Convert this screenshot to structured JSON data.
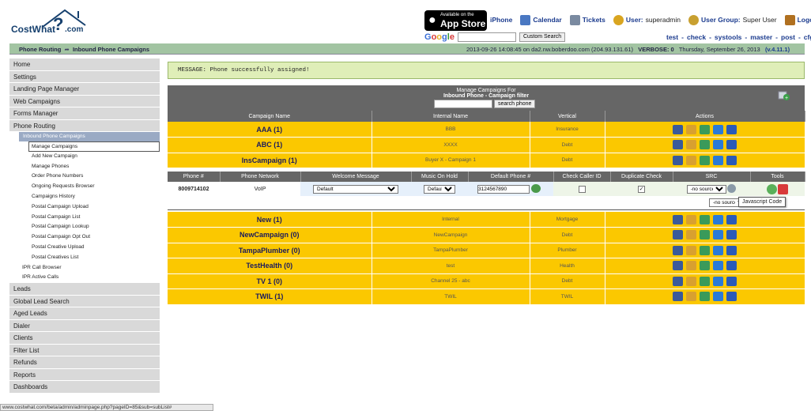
{
  "brand": {
    "logo_text": "CostWhat",
    "logo_q": "?",
    "logo_com": ".com"
  },
  "appstore": {
    "line1": "Available on the",
    "line2": "App Store"
  },
  "topnav": {
    "iphone": "iPhone",
    "calendar": "Calendar",
    "tickets": "Tickets",
    "user_label": "User:",
    "user_value": "superadmin",
    "group_label": "User Group:",
    "group_value": "Super User",
    "logout": "Logout"
  },
  "google": {
    "logo": "Google",
    "button": "Custom Search"
  },
  "subnav": [
    "test",
    "-",
    "check",
    "-",
    "systools",
    "-",
    "master",
    "-",
    "post",
    "-",
    "cfg"
  ],
  "breadcrumb": {
    "parent": "Phone Routing",
    "child": "Inbound Phone Campaigns"
  },
  "server": {
    "info": "2013-09-26 14:08:45 on da2.nw.boberdoo.com (204.93.131.61)",
    "verbose": "VERBOSE: 0",
    "date": "Thursday, September 26, 2013",
    "version": "(v.4.11.1)"
  },
  "sidebar": {
    "items_top": [
      "Home",
      "Settings",
      "Landing Page Manager",
      "Web Campaigns",
      "Forms Manager",
      "Phone Routing"
    ],
    "subhead": "Inbound Phone Campaigns",
    "subitems": [
      "Manage Campaigns",
      "Add New Campaign",
      "Manage Phones",
      "Order Phone Numbers",
      "Ongoing Requests Browser",
      "Campaigns History",
      "Postal Campaign Upload",
      "Postal Campaign List",
      "Postal Campaign Lookup",
      "Postal Campaign Opt Out",
      "Postal Creative Upload",
      "Postal Creatives List"
    ],
    "subitems2": [
      "IPR Call Browser",
      "IPR Active Calls"
    ],
    "items_bottom": [
      "Leads",
      "Global Lead Search",
      "Aged Leads",
      "Dialer",
      "Clients",
      "Filter List",
      "Refunds",
      "Reports",
      "Dashboards"
    ]
  },
  "message": "MESSAGE: Phone successfully assigned!",
  "manage": {
    "title1": "Manage Campaigns For",
    "title2": "Inbound Phone - Campaign filter",
    "search_button": "search phone"
  },
  "campaign_headers": [
    "Campaign Name",
    "Internal Name",
    "Vertical",
    "Actions"
  ],
  "campaigns_top": [
    {
      "name": "AAA (1)",
      "internal": "BBB",
      "vertical": "Insurance"
    },
    {
      "name": "ABC (1)",
      "internal": "XXXX",
      "vertical": "Debt"
    },
    {
      "name": "InsCampaign (1)",
      "internal": "Buyer X - Campaign 1",
      "vertical": "Debt"
    }
  ],
  "phone_headers": [
    "Phone #",
    "Phone Network",
    "Welcome Message",
    "Music On Hold",
    "Default Phone #",
    "Check Caller ID",
    "Duplicate Check",
    "SRC",
    "Tools"
  ],
  "phone_row": {
    "number": "8009714102",
    "network": "VoIP",
    "welcome": "Default",
    "music": "Default",
    "default_phone": "3124567890",
    "src": "-no source-",
    "src2": "-no source-",
    "tooltip": "Javascript Code"
  },
  "campaigns_bottom": [
    {
      "name": "New (1)",
      "internal": "Internal",
      "vertical": "Mortgage"
    },
    {
      "name": "NewCampaign (0)",
      "internal": "NewCampaign",
      "vertical": "Debt"
    },
    {
      "name": "TampaPlumber (0)",
      "internal": "TampaPlumber",
      "vertical": "Plumber"
    },
    {
      "name": "TestHealth (0)",
      "internal": "test",
      "vertical": "Health"
    },
    {
      "name": "TV 1 (0)",
      "internal": "Channel 25 - abc",
      "vertical": "Debt"
    },
    {
      "name": "TWIL (1)",
      "internal": "TWIL",
      "vertical": "TWIL"
    }
  ],
  "statusbar": "www.costwhat.com/beta/admin/adminpage.php?pageID=85&sub=subList#",
  "colors": {
    "campaign_row": "#fbc800",
    "header_gray": "#666666",
    "breadcrumb_green": "#a2c4a2",
    "message_bg": "#dfeeb8"
  }
}
